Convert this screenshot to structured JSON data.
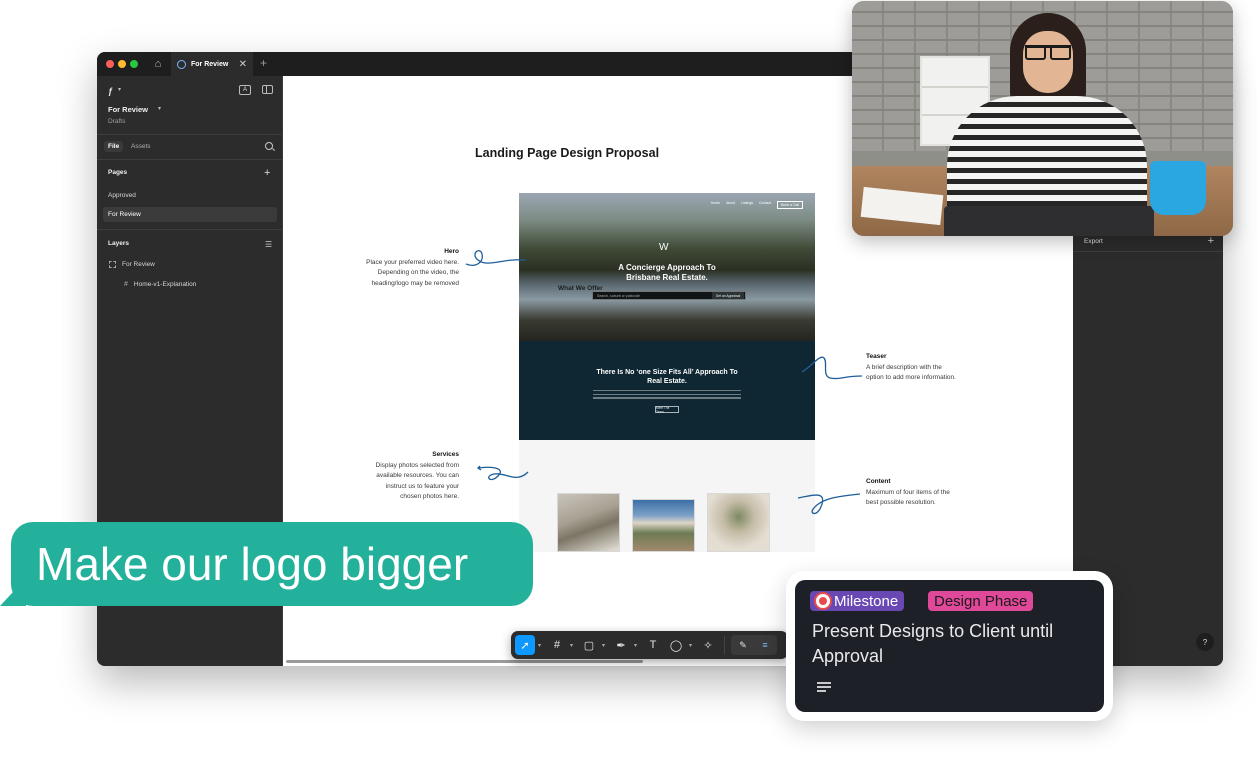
{
  "window": {
    "tab_title": "For Review",
    "close_glyph": "✕",
    "add_tab_glyph": "+"
  },
  "sidebar": {
    "file_name": "For Review",
    "file_location": "Drafts",
    "tabs": [
      "File",
      "Assets"
    ],
    "pages_title": "Pages",
    "pages": [
      "Approved",
      "For Review"
    ],
    "active_page": "For Review",
    "layers_title": "Layers",
    "layers": [
      {
        "name": "For Review",
        "type": "frame-icon"
      },
      {
        "name": "Home-v1-Explanation",
        "type": "hash-icon"
      }
    ]
  },
  "right_panel": {
    "export_label": "Export",
    "help_glyph": "?"
  },
  "canvas": {
    "title": "Landing Page Design Proposal",
    "mockup": {
      "nav_items": [
        "Home",
        "About",
        "Listings",
        "Contact",
        "Book a Call"
      ],
      "hero_logo": "W",
      "hero_title_1": "A Concierge Approach To",
      "hero_title_2": "Brisbane Real Estate.",
      "search_placeholder": "Search, suburb or postcode",
      "search_button": "Get an Appraisal",
      "teaser_title_1": "There Is No ‘one Size Fits All’ Approach To",
      "teaser_title_2": "Real Estate.",
      "teaser_button": "Meet The Team",
      "offer_title": "What We Offer"
    },
    "annotations": {
      "hero": {
        "title": "Hero",
        "lines": [
          "Place your preferred video here.",
          "Depending on the video, the",
          "heading/logo may be removed"
        ]
      },
      "teaser": {
        "title": "Teaser",
        "lines": [
          "A brief description with the",
          "option to add more information."
        ]
      },
      "services": {
        "title": "Services",
        "lines": [
          "Display photos selected from",
          "available resources. You can",
          "instruct us to feature your",
          "chosen photos here."
        ]
      },
      "content": {
        "title": "Content",
        "lines": [
          "Maximum of four items of the",
          "best possible resolution."
        ]
      }
    }
  },
  "toolbar": {
    "tools": [
      "move-tool",
      "frame-tool",
      "shape-tool",
      "pen-tool",
      "text-tool",
      "comment-tool",
      "actions-tool"
    ],
    "active_tool": "move-tool",
    "text_tool_glyph": "T"
  },
  "chat": {
    "message": "Make our logo bigger",
    "color": "#24b19b"
  },
  "task_card": {
    "tags": [
      {
        "label": "Milestone",
        "color": "#6948b4"
      },
      {
        "label": "Design Phase",
        "color": "#e04899"
      }
    ],
    "title": "Present Designs to Client until Approval"
  }
}
